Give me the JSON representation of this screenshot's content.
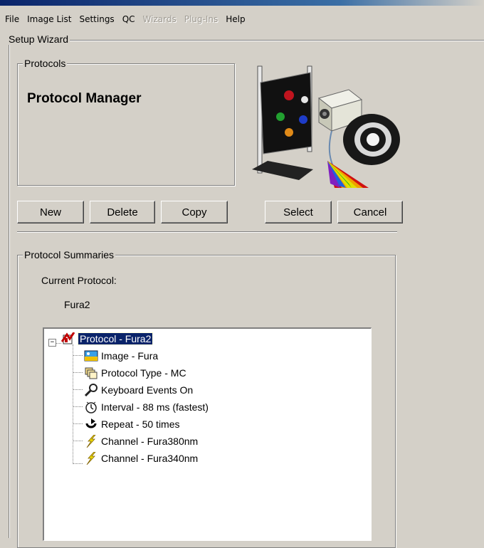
{
  "menu": {
    "items": [
      {
        "label": "File",
        "enabled": true
      },
      {
        "label": "Image List",
        "enabled": true
      },
      {
        "label": "Settings",
        "enabled": true
      },
      {
        "label": "QC",
        "enabled": true
      },
      {
        "label": "Wizards",
        "enabled": false
      },
      {
        "label": "Plug-Ins",
        "enabled": false
      },
      {
        "label": "Help",
        "enabled": true
      }
    ]
  },
  "setup": {
    "legend": "Setup Wizard"
  },
  "protocols": {
    "legend": "Protocols",
    "title": "Protocol Manager"
  },
  "buttons": {
    "new": "New",
    "delete": "Delete",
    "copy": "Copy",
    "select": "Select",
    "cancel": "Cancel"
  },
  "summaries": {
    "legend": "Protocol Summaries",
    "current_label": "Current Protocol:",
    "current_value": "Fura2"
  },
  "tree": {
    "root": {
      "label": "Protocol - Fura2",
      "icon": "protocol-icon",
      "selected": true,
      "expanded": true
    },
    "children": [
      {
        "label": "Image - Fura",
        "icon": "image-icon"
      },
      {
        "label": "Protocol Type - MC",
        "icon": "protocol-type-icon"
      },
      {
        "label": "Keyboard Events On",
        "icon": "keyboard-events-icon"
      },
      {
        "label": "Interval - 88 ms (fastest)",
        "icon": "interval-clock-icon"
      },
      {
        "label": "Repeat - 50 times",
        "icon": "repeat-icon"
      },
      {
        "label": "Channel - Fura380nm",
        "icon": "channel-lightning-icon"
      },
      {
        "label": "Channel - Fura340nm",
        "icon": "channel-lightning-icon"
      }
    ]
  },
  "colors": {
    "window_bg": "#d4d0c8",
    "selection": "#0a246a",
    "title_bar": "#0a246a"
  }
}
